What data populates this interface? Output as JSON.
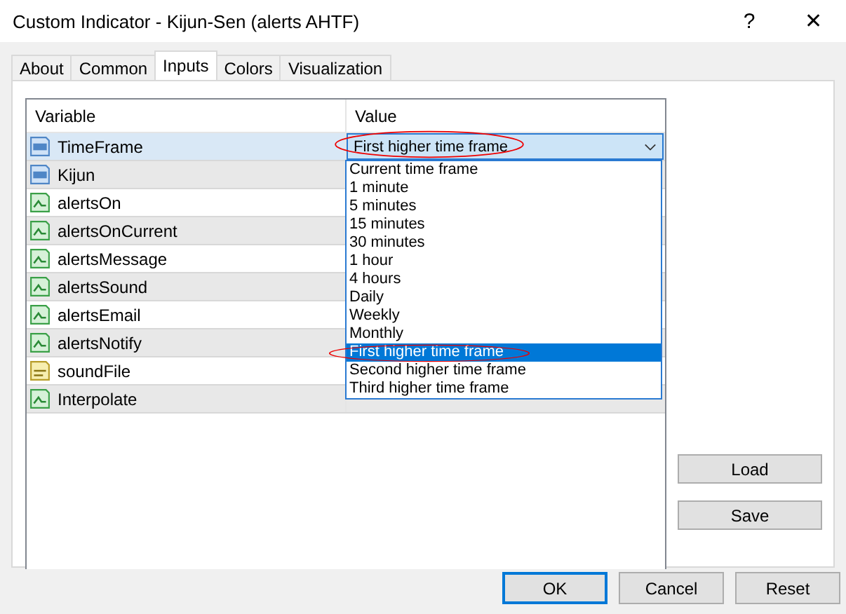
{
  "window": {
    "title": "Custom Indicator - Kijun-Sen (alerts AHTF)",
    "help": "?",
    "close": "✕"
  },
  "tabs": [
    {
      "label": "About",
      "selected": false
    },
    {
      "label": "Common",
      "selected": false
    },
    {
      "label": "Inputs",
      "selected": true
    },
    {
      "label": "Colors",
      "selected": false
    },
    {
      "label": "Visualization",
      "selected": false
    }
  ],
  "table": {
    "columns": [
      "Variable",
      "Value"
    ],
    "rows": [
      {
        "kind": "int",
        "name": "TimeFrame",
        "selected": true,
        "value": "First higher time frame"
      },
      {
        "kind": "int",
        "name": "Kijun",
        "selected": false
      },
      {
        "kind": "bool",
        "name": "alertsOn",
        "selected": false
      },
      {
        "kind": "bool",
        "name": "alertsOnCurrent",
        "selected": false
      },
      {
        "kind": "bool",
        "name": "alertsMessage",
        "selected": false
      },
      {
        "kind": "bool",
        "name": "alertsSound",
        "selected": false
      },
      {
        "kind": "bool",
        "name": "alertsEmail",
        "selected": false
      },
      {
        "kind": "bool",
        "name": "alertsNotify",
        "selected": false
      },
      {
        "kind": "string",
        "name": "soundFile",
        "selected": false
      },
      {
        "kind": "bool",
        "name": "Interpolate",
        "selected": false
      }
    ]
  },
  "dropdown": {
    "options": [
      {
        "label": "Current time frame",
        "selected": false
      },
      {
        "label": "1 minute",
        "selected": false
      },
      {
        "label": "5 minutes",
        "selected": false
      },
      {
        "label": "15 minutes",
        "selected": false
      },
      {
        "label": "30 minutes",
        "selected": false
      },
      {
        "label": "1 hour",
        "selected": false
      },
      {
        "label": "4 hours",
        "selected": false
      },
      {
        "label": "Daily",
        "selected": false
      },
      {
        "label": "Weekly",
        "selected": false
      },
      {
        "label": "Monthly",
        "selected": false
      },
      {
        "label": "First higher time frame",
        "selected": true
      },
      {
        "label": "Second higher time frame",
        "selected": false
      },
      {
        "label": "Third higher time frame",
        "selected": false
      }
    ]
  },
  "side_buttons": [
    "Load",
    "Save"
  ],
  "buttons": [
    {
      "label": "OK",
      "default": true
    },
    {
      "label": "Cancel",
      "default": false
    },
    {
      "label": "Reset",
      "default": false
    }
  ]
}
